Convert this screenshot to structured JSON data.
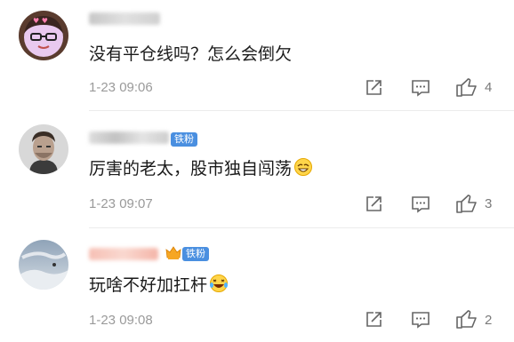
{
  "comments": [
    {
      "text": "没有平仓线吗？怎么会倒欠",
      "time": "1-23 09:06",
      "likes": "4",
      "badge": "",
      "emoji": ""
    },
    {
      "text": "厉害的老太，股市独自闯荡",
      "time": "1-23 09:07",
      "likes": "3",
      "badge": "铁粉",
      "emoji": "grin-emoji"
    },
    {
      "text": "玩啥不好加扛杆",
      "time": "1-23 09:08",
      "likes": "2",
      "badge": "铁粉",
      "emoji": "laugh-cry-emoji"
    }
  ],
  "icons": [
    "share-icon",
    "reply-icon",
    "like-icon"
  ],
  "colors": {
    "badge": "#4a8fe0",
    "meta": "#9a9a9a",
    "text": "#1a1a1a"
  }
}
